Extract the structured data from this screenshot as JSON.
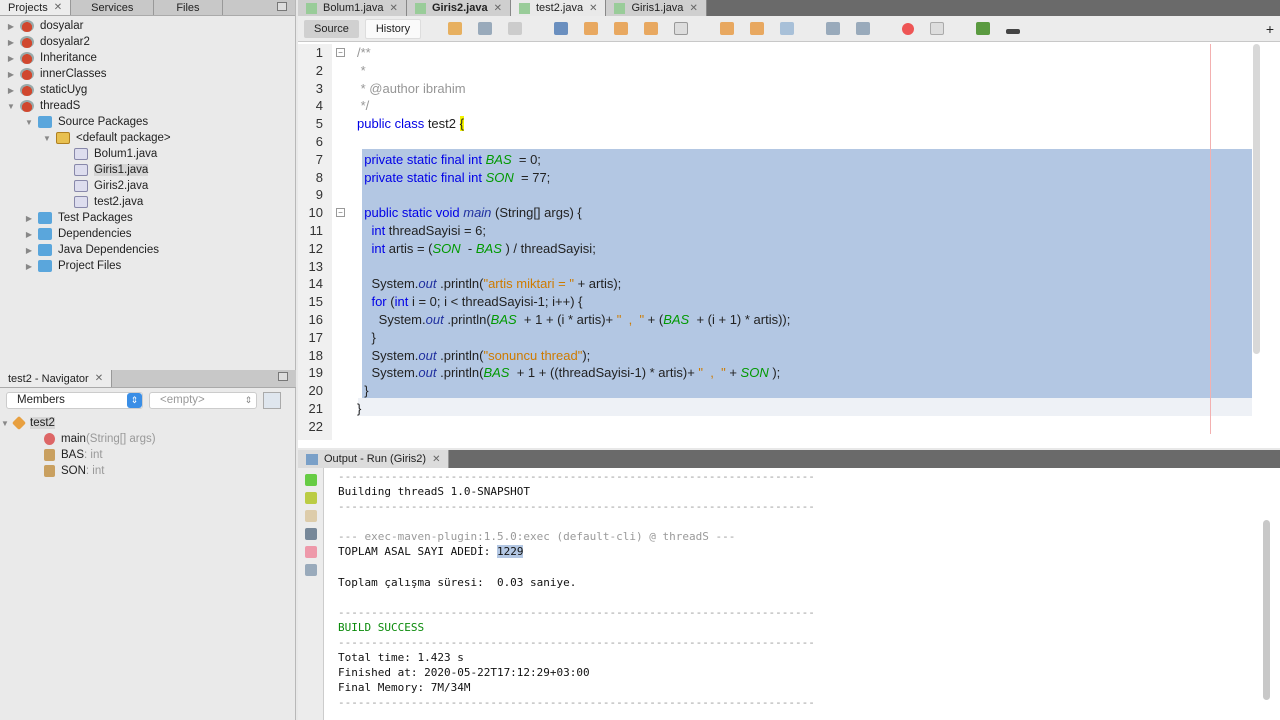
{
  "projects_panel": {
    "tabs": [
      "Projects",
      "Services",
      "Files"
    ],
    "tree": [
      {
        "label": "dosyalar",
        "depth": 0,
        "icon": "project",
        "arrow": "▶"
      },
      {
        "label": "dosyalar2",
        "depth": 0,
        "icon": "project",
        "arrow": "▶"
      },
      {
        "label": "Inheritance",
        "depth": 0,
        "icon": "project",
        "arrow": "▶"
      },
      {
        "label": "innerClasses",
        "depth": 0,
        "icon": "project",
        "arrow": "▶"
      },
      {
        "label": "staticUyg",
        "depth": 0,
        "icon": "project",
        "arrow": "▶"
      },
      {
        "label": "threadS",
        "depth": 0,
        "icon": "project",
        "arrow": "▼"
      },
      {
        "label": "Source Packages",
        "depth": 1,
        "icon": "folder",
        "arrow": "▼"
      },
      {
        "label": "<default package>",
        "depth": 2,
        "icon": "package",
        "arrow": "▼"
      },
      {
        "label": "Bolum1.java",
        "depth": 3,
        "icon": "java",
        "arrow": ""
      },
      {
        "label": "Giris1.java",
        "depth": 3,
        "icon": "java",
        "arrow": "",
        "selected": true
      },
      {
        "label": "Giris2.java",
        "depth": 3,
        "icon": "java",
        "arrow": ""
      },
      {
        "label": "test2.java",
        "depth": 3,
        "icon": "java",
        "arrow": ""
      },
      {
        "label": "Test Packages",
        "depth": 1,
        "icon": "folder",
        "arrow": "▶"
      },
      {
        "label": "Dependencies",
        "depth": 1,
        "icon": "folder",
        "arrow": "▶"
      },
      {
        "label": "Java Dependencies",
        "depth": 1,
        "icon": "folder",
        "arrow": "▶"
      },
      {
        "label": "Project Files",
        "depth": 1,
        "icon": "folder",
        "arrow": "▶"
      }
    ]
  },
  "navigator": {
    "title": "test2 - Navigator",
    "filter": "Members",
    "secondary": "<empty>",
    "root": "test2",
    "members": [
      {
        "name": "main",
        "detail": "(String[] args)"
      },
      {
        "name": "BAS",
        "detail": " : int"
      },
      {
        "name": "SON",
        "detail": " : int"
      }
    ]
  },
  "editor": {
    "tabs": [
      "Bolum1.java",
      "Giris2.java",
      "test2.java",
      "Giris1.java"
    ],
    "active_tab": "test2.java",
    "source_label": "Source",
    "history_label": "History",
    "lines": [
      [
        [
          "cm",
          "/**"
        ]
      ],
      [
        [
          "cm",
          " *"
        ]
      ],
      [
        [
          "cm",
          " * @author ibrahim"
        ]
      ],
      [
        [
          "cm",
          " */"
        ]
      ],
      [
        [
          "kw",
          "public class "
        ],
        [
          "pl",
          "test2 "
        ],
        [
          "brace",
          "{"
        ]
      ],
      [],
      [
        [
          "pl",
          "  "
        ],
        [
          "kw",
          "private static final int "
        ],
        [
          "fld",
          "BAS"
        ],
        [
          "pl",
          "  = 0;"
        ]
      ],
      [
        [
          "pl",
          "  "
        ],
        [
          "kw",
          "private static final int "
        ],
        [
          "fld",
          "SON"
        ],
        [
          "pl",
          "  = 77;"
        ]
      ],
      [],
      [
        [
          "pl",
          "  "
        ],
        [
          "kw",
          "public static void "
        ],
        [
          "it",
          "main"
        ],
        [
          "pl",
          " (String[] args) {"
        ]
      ],
      [
        [
          "pl",
          "    "
        ],
        [
          "kw",
          "int "
        ],
        [
          "pl",
          "threadSayisi = 6;"
        ]
      ],
      [
        [
          "pl",
          "    "
        ],
        [
          "kw",
          "int "
        ],
        [
          "pl",
          "artis = ("
        ],
        [
          "fld",
          "SON"
        ],
        [
          "pl",
          "  - "
        ],
        [
          "fld",
          "BAS"
        ],
        [
          "pl",
          " ) / threadSayisi;"
        ]
      ],
      [],
      [
        [
          "pl",
          "    System."
        ],
        [
          "it",
          "out"
        ],
        [
          "pl",
          " .println("
        ],
        [
          "str",
          "\"artis miktari = \""
        ],
        [
          "pl",
          " + artis);"
        ]
      ],
      [
        [
          "pl",
          "    "
        ],
        [
          "kw",
          "for "
        ],
        [
          "pl",
          "("
        ],
        [
          "kw",
          "int "
        ],
        [
          "pl",
          "i = 0; i < threadSayisi-1; i++) {"
        ]
      ],
      [
        [
          "pl",
          "      System."
        ],
        [
          "it",
          "out"
        ],
        [
          "pl",
          " .println("
        ],
        [
          "fld",
          "BAS"
        ],
        [
          "pl",
          "  + 1 + (i * artis)+ "
        ],
        [
          "str",
          "\"  ,  \""
        ],
        [
          "pl",
          " + ("
        ],
        [
          "fld",
          "BAS"
        ],
        [
          "pl",
          "  + (i + 1) * artis));"
        ]
      ],
      [
        [
          "pl",
          "    }"
        ]
      ],
      [
        [
          "pl",
          "    System."
        ],
        [
          "it",
          "out"
        ],
        [
          "pl",
          " .println("
        ],
        [
          "str",
          "\"sonuncu thread\""
        ],
        [
          "pl",
          ");"
        ]
      ],
      [
        [
          "pl",
          "    System."
        ],
        [
          "it",
          "out"
        ],
        [
          "pl",
          " .println("
        ],
        [
          "fld",
          "BAS"
        ],
        [
          "pl",
          "  + 1 + ((threadSayisi-1) * artis)+ "
        ],
        [
          "str",
          "\"  ,  \""
        ],
        [
          "pl",
          " + "
        ],
        [
          "fld",
          "SON"
        ],
        [
          "pl",
          " );"
        ]
      ],
      [
        [
          "pl",
          "  }"
        ]
      ],
      [
        [
          "pl",
          "}"
        ]
      ],
      []
    ]
  },
  "output": {
    "title": "Output - Run (Giris2)",
    "lines": [
      {
        "t": "gray",
        "s": "------------------------------------------------------------------------"
      },
      {
        "t": "pl",
        "s": "Building threadS 1.0-SNAPSHOT"
      },
      {
        "t": "gray",
        "s": "------------------------------------------------------------------------"
      },
      {
        "t": "pl",
        "s": ""
      },
      {
        "t": "gray",
        "s": "--- exec-maven-plugin:1.5.0:exec (default-cli) @ threadS ---"
      },
      {
        "t": "pl",
        "s": "TOPLAM ASAL SAYI ADEDİ: ",
        "hl": "1229"
      },
      {
        "t": "pl",
        "s": ""
      },
      {
        "t": "pl",
        "s": "Toplam çalışma süresi:  0.03 saniye."
      },
      {
        "t": "pl",
        "s": ""
      },
      {
        "t": "gray",
        "s": "------------------------------------------------------------------------"
      },
      {
        "t": "grn",
        "s": "BUILD SUCCESS"
      },
      {
        "t": "gray",
        "s": "------------------------------------------------------------------------"
      },
      {
        "t": "pl",
        "s": "Total time: 1.423 s"
      },
      {
        "t": "pl",
        "s": "Finished at: 2020-05-22T17:12:29+03:00"
      },
      {
        "t": "pl",
        "s": "Final Memory: 7M/34M"
      },
      {
        "t": "gray",
        "s": "------------------------------------------------------------------------"
      }
    ]
  }
}
